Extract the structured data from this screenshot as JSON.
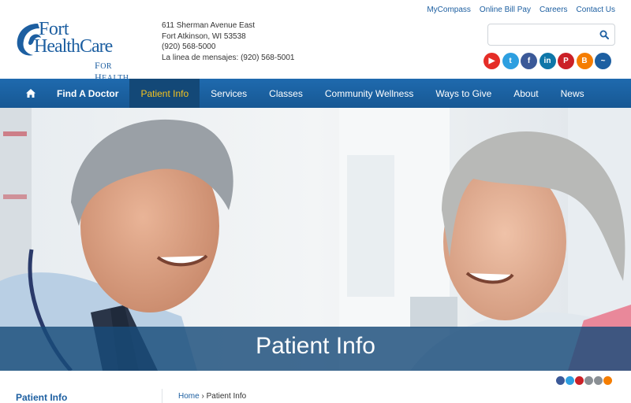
{
  "logo": {
    "line1": "Fort",
    "line2": "HealthCare",
    "tagline_big1": "F",
    "tagline_small1": "OR ",
    "tagline_big2": "H",
    "tagline_small2": "EALTH"
  },
  "address": {
    "street": "611 Sherman Avenue East",
    "city": "Fort Atkinson, WI 53538",
    "phone": "(920) 568-5000",
    "message_line": "La linea de mensajes: (920) 568-5001"
  },
  "top_links": [
    "MyCompass",
    "Online Bill Pay",
    "Careers",
    "Contact Us"
  ],
  "search": {
    "placeholder": "",
    "value": ""
  },
  "social_icons": [
    {
      "name": "youtube-icon",
      "color": "#e52d27",
      "glyph": "▶"
    },
    {
      "name": "twitter-icon",
      "color": "#2d9fe0",
      "glyph": "t"
    },
    {
      "name": "facebook-icon",
      "color": "#3b5998",
      "glyph": "f"
    },
    {
      "name": "linkedin-icon",
      "color": "#0e76a8",
      "glyph": "in"
    },
    {
      "name": "pinterest-icon",
      "color": "#cb2027",
      "glyph": "P"
    },
    {
      "name": "blogger-icon",
      "color": "#f57d00",
      "glyph": "B"
    },
    {
      "name": "swimmer-icon",
      "color": "#1d5fa1",
      "glyph": "~"
    }
  ],
  "nav": {
    "home_icon": "home-icon",
    "items": [
      "Find A Doctor",
      "Patient Info",
      "Services",
      "Classes",
      "Community Wellness",
      "Ways to Give",
      "About",
      "News"
    ],
    "active": "Patient Info"
  },
  "hero": {
    "title": "Patient Info"
  },
  "share_icons": [
    {
      "name": "facebook-share-icon",
      "color": "#3b5998"
    },
    {
      "name": "twitter-share-icon",
      "color": "#2d9fe0"
    },
    {
      "name": "pinterest-share-icon",
      "color": "#cb2027"
    },
    {
      "name": "email-share-icon",
      "color": "#8a8f94"
    },
    {
      "name": "print-share-icon",
      "color": "#8a8f94"
    },
    {
      "name": "blogger-share-icon",
      "color": "#f57d00"
    }
  ],
  "sidebar": {
    "title": "Patient Info"
  },
  "breadcrumb": {
    "home": "Home",
    "separator": "›",
    "current": "Patient Info"
  },
  "colors": {
    "brand_blue": "#1d5fa1",
    "nav_active_text": "#f5c41f",
    "nav_active_bg": "#134877"
  }
}
